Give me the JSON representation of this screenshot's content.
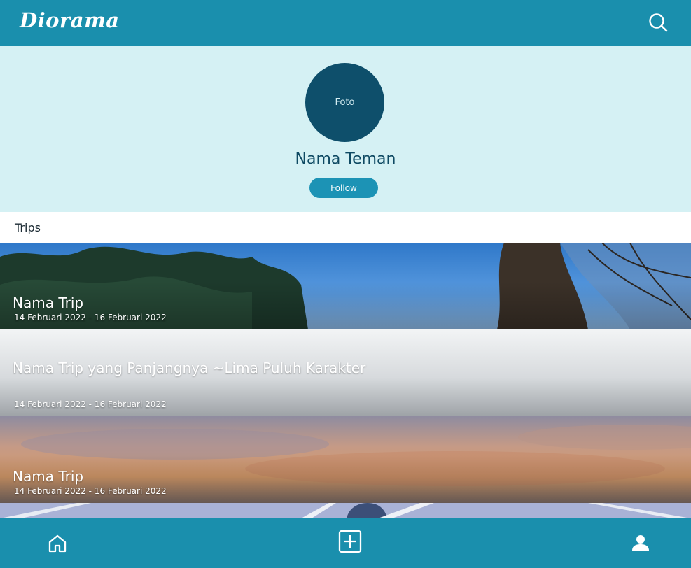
{
  "app": {
    "logo_text": "Diorama"
  },
  "topbar": {
    "search_icon": "search-icon"
  },
  "profile": {
    "avatar_label": "Foto",
    "name": "Nama Teman",
    "follow_label": "Follow"
  },
  "trips_section": {
    "title": "Trips"
  },
  "trips": [
    {
      "name": "Nama Trip",
      "date": "14 Februari 2022 - 16 Februari 2022"
    },
    {
      "name": "Nama Trip yang Panjangnya ~Lima Puluh Karakter",
      "date": "14 Februari 2022 - 16 Februari 2022"
    },
    {
      "name": "Nama Trip",
      "date": "14 Februari 2022 - 16 Februari 2022"
    }
  ],
  "bottom_nav": [
    {
      "icon": "home-icon"
    },
    {
      "icon": "add-square-icon"
    },
    {
      "icon": "profile-icon"
    }
  ],
  "colors": {
    "primary": "#1a8fad",
    "profile_bg": "#d5f1f4",
    "avatar_bg": "#0e4f6b",
    "name_text": "#0f4a63"
  }
}
